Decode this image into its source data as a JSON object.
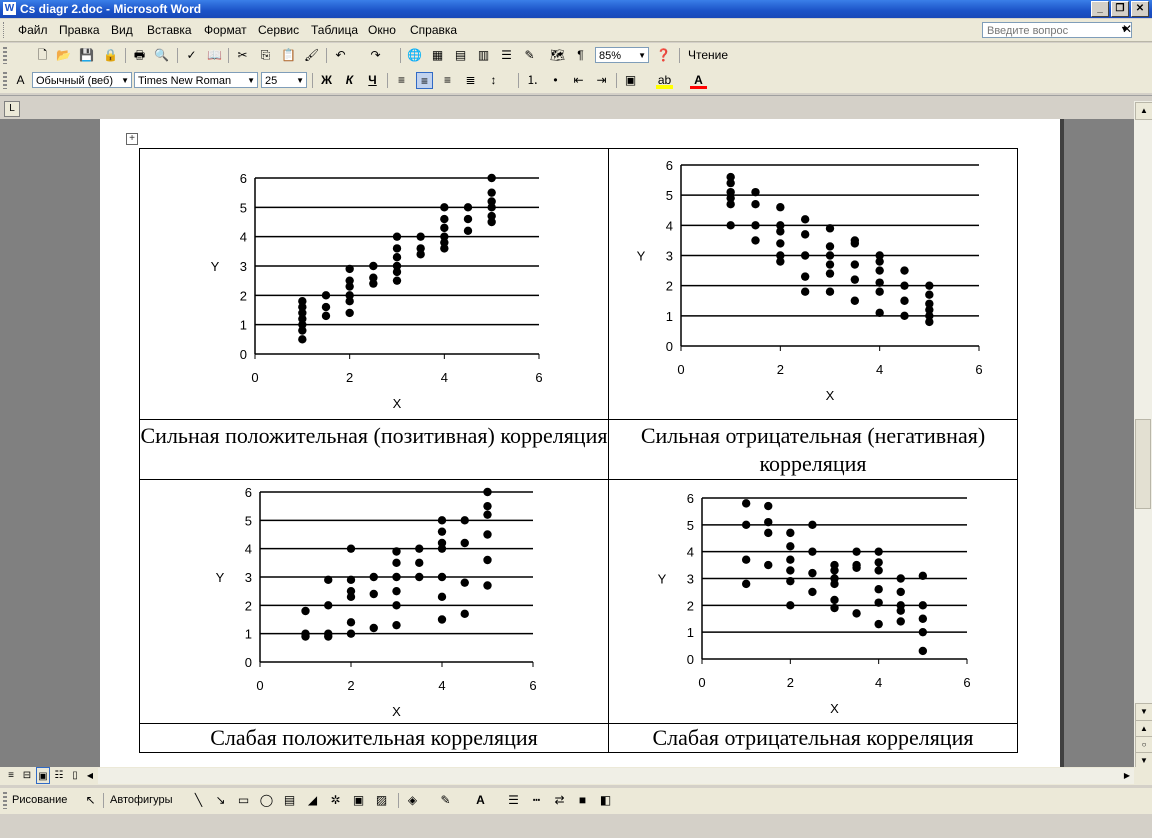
{
  "window": {
    "title": "Cs diagr 2.doc - Microsoft Word",
    "minimize": "_",
    "restore": "❐",
    "close": "✕"
  },
  "menubar": {
    "items": [
      "Файл",
      "Правка",
      "Вид",
      "Вставка",
      "Формат",
      "Сервис",
      "Таблица",
      "Окно",
      "Справка"
    ],
    "ask_placeholder": "Введите вопрос"
  },
  "toolbar": {
    "zoom": "85%",
    "reading": "Чтение",
    "style": "Обычный (веб)",
    "font": "Times New Roman",
    "size": "25",
    "bold": "Ж",
    "italic": "К",
    "underline": "Ч"
  },
  "drawing": {
    "draw_label": "Рисование",
    "autoshapes_label": "Автофигуры"
  },
  "charts": [
    {
      "type": "scatter",
      "xlabel": "X",
      "ylabel": "Y",
      "xlim": [
        0,
        6
      ],
      "ylim": [
        0,
        6
      ],
      "xticks": [
        0,
        2,
        4,
        6
      ],
      "yticks": [
        0,
        1,
        2,
        3,
        4,
        5,
        6
      ],
      "points": [
        [
          1,
          0.5
        ],
        [
          1,
          0.8
        ],
        [
          1,
          1.0
        ],
        [
          1,
          1.2
        ],
        [
          1,
          1.4
        ],
        [
          1,
          1.6
        ],
        [
          1,
          1.8
        ],
        [
          1.5,
          1.3
        ],
        [
          1.5,
          1.6
        ],
        [
          1.5,
          2.0
        ],
        [
          2,
          1.4
        ],
        [
          2,
          1.8
        ],
        [
          2,
          2.0
        ],
        [
          2,
          2.3
        ],
        [
          2,
          2.5
        ],
        [
          2,
          2.9
        ],
        [
          2.5,
          2.4
        ],
        [
          2.5,
          2.6
        ],
        [
          2.5,
          3.0
        ],
        [
          3,
          2.5
        ],
        [
          3,
          2.8
        ],
        [
          3,
          3.0
        ],
        [
          3,
          3.3
        ],
        [
          3,
          3.6
        ],
        [
          3,
          4.0
        ],
        [
          3.5,
          3.4
        ],
        [
          3.5,
          3.6
        ],
        [
          3.5,
          4.0
        ],
        [
          4,
          3.6
        ],
        [
          4,
          3.8
        ],
        [
          4,
          4.0
        ],
        [
          4,
          4.3
        ],
        [
          4,
          4.6
        ],
        [
          4,
          5.0
        ],
        [
          4.5,
          4.2
        ],
        [
          4.5,
          4.6
        ],
        [
          4.5,
          5.0
        ],
        [
          5,
          4.5
        ],
        [
          5,
          4.7
        ],
        [
          5,
          5.0
        ],
        [
          5,
          5.2
        ],
        [
          5,
          5.5
        ],
        [
          5,
          6.0
        ]
      ]
    },
    {
      "type": "scatter",
      "xlabel": "X",
      "ylabel": "Y",
      "xlim": [
        0,
        6
      ],
      "ylim": [
        0,
        6
      ],
      "xticks": [
        0,
        2,
        4,
        6
      ],
      "yticks": [
        0,
        1,
        2,
        3,
        4,
        5,
        6
      ],
      "points": [
        [
          1,
          4.0
        ],
        [
          1,
          4.7
        ],
        [
          1,
          4.9
        ],
        [
          1,
          5.1
        ],
        [
          1,
          5.4
        ],
        [
          1,
          5.6
        ],
        [
          1.5,
          3.5
        ],
        [
          1.5,
          4.0
        ],
        [
          1.5,
          4.7
        ],
        [
          1.5,
          5.1
        ],
        [
          2,
          2.8
        ],
        [
          2,
          3.0
        ],
        [
          2,
          3.4
        ],
        [
          2,
          3.8
        ],
        [
          2,
          4.0
        ],
        [
          2,
          4.6
        ],
        [
          2.5,
          1.8
        ],
        [
          2.5,
          2.3
        ],
        [
          2.5,
          3.0
        ],
        [
          2.5,
          3.7
        ],
        [
          2.5,
          4.2
        ],
        [
          3,
          1.8
        ],
        [
          3,
          2.4
        ],
        [
          3,
          2.7
        ],
        [
          3,
          3.0
        ],
        [
          3,
          3.3
        ],
        [
          3,
          3.9
        ],
        [
          3.5,
          1.5
        ],
        [
          3.5,
          2.2
        ],
        [
          3.5,
          2.7
        ],
        [
          3.5,
          3.4
        ],
        [
          3.5,
          3.5
        ],
        [
          4,
          1.1
        ],
        [
          4,
          1.8
        ],
        [
          4,
          2.1
        ],
        [
          4,
          2.5
        ],
        [
          4,
          2.8
        ],
        [
          4,
          3.0
        ],
        [
          4.5,
          1.0
        ],
        [
          4.5,
          1.5
        ],
        [
          4.5,
          2.0
        ],
        [
          4.5,
          2.5
        ],
        [
          5,
          0.8
        ],
        [
          5,
          1.0
        ],
        [
          5,
          1.2
        ],
        [
          5,
          1.4
        ],
        [
          5,
          1.7
        ],
        [
          5,
          2.0
        ]
      ]
    },
    {
      "type": "scatter",
      "xlabel": "X",
      "ylabel": "Y",
      "xlim": [
        0,
        6
      ],
      "ylim": [
        0,
        6
      ],
      "xticks": [
        0,
        2,
        4,
        6
      ],
      "yticks": [
        0,
        1,
        2,
        3,
        4,
        5,
        6
      ],
      "points": [
        [
          1,
          0.9
        ],
        [
          1,
          1.0
        ],
        [
          1,
          1.8
        ],
        [
          1.5,
          0.9
        ],
        [
          1.5,
          1.0
        ],
        [
          1.5,
          2.0
        ],
        [
          1.5,
          2.9
        ],
        [
          2,
          1.0
        ],
        [
          2,
          1.4
        ],
        [
          2,
          2.3
        ],
        [
          2,
          2.5
        ],
        [
          2,
          2.9
        ],
        [
          2,
          4.0
        ],
        [
          2.5,
          1.2
        ],
        [
          2.5,
          2.4
        ],
        [
          2.5,
          3.0
        ],
        [
          3,
          1.3
        ],
        [
          3,
          2.0
        ],
        [
          3,
          2.5
        ],
        [
          3,
          3.0
        ],
        [
          3,
          3.5
        ],
        [
          3,
          3.9
        ],
        [
          3.5,
          3.0
        ],
        [
          3.5,
          3.5
        ],
        [
          3.5,
          4.0
        ],
        [
          4,
          1.5
        ],
        [
          4,
          2.3
        ],
        [
          4,
          3.0
        ],
        [
          4,
          4.0
        ],
        [
          4,
          4.2
        ],
        [
          4,
          4.6
        ],
        [
          4,
          5.0
        ],
        [
          4.5,
          1.7
        ],
        [
          4.5,
          2.8
        ],
        [
          4.5,
          4.2
        ],
        [
          4.5,
          5.0
        ],
        [
          5,
          2.7
        ],
        [
          5,
          3.6
        ],
        [
          5,
          4.5
        ],
        [
          5,
          5.2
        ],
        [
          5,
          5.5
        ],
        [
          5,
          6.0
        ]
      ]
    },
    {
      "type": "scatter",
      "xlabel": "X",
      "ylabel": "Y",
      "xlim": [
        0,
        6
      ],
      "ylim": [
        0,
        6
      ],
      "xticks": [
        0,
        2,
        4,
        6
      ],
      "yticks": [
        0,
        1,
        2,
        3,
        4,
        5,
        6
      ],
      "points": [
        [
          1,
          2.8
        ],
        [
          1,
          3.7
        ],
        [
          1,
          5.0
        ],
        [
          1,
          5.8
        ],
        [
          1.5,
          3.5
        ],
        [
          1.5,
          4.7
        ],
        [
          1.5,
          5.1
        ],
        [
          1.5,
          5.7
        ],
        [
          2,
          2.0
        ],
        [
          2,
          2.9
        ],
        [
          2,
          3.3
        ],
        [
          2,
          3.7
        ],
        [
          2,
          4.2
        ],
        [
          2,
          4.7
        ],
        [
          2.5,
          2.5
        ],
        [
          2.5,
          3.2
        ],
        [
          2.5,
          4.0
        ],
        [
          2.5,
          5.0
        ],
        [
          3,
          1.9
        ],
        [
          3,
          2.2
        ],
        [
          3,
          2.8
        ],
        [
          3,
          3.0
        ],
        [
          3,
          3.3
        ],
        [
          3,
          3.5
        ],
        [
          3.5,
          1.7
        ],
        [
          3.5,
          3.4
        ],
        [
          3.5,
          3.5
        ],
        [
          3.5,
          4.0
        ],
        [
          4,
          1.3
        ],
        [
          4,
          2.1
        ],
        [
          4,
          2.6
        ],
        [
          4,
          3.3
        ],
        [
          4,
          3.6
        ],
        [
          4,
          4.0
        ],
        [
          4.5,
          1.4
        ],
        [
          4.5,
          1.8
        ],
        [
          4.5,
          2.0
        ],
        [
          4.5,
          2.5
        ],
        [
          4.5,
          3.0
        ],
        [
          5,
          0.3
        ],
        [
          5,
          1.0
        ],
        [
          5,
          1.5
        ],
        [
          5,
          2.0
        ],
        [
          5,
          3.1
        ]
      ]
    }
  ],
  "captions": {
    "c1": "Сильная положительная (позитивная) корреляция",
    "c2": "Сильная отрицательная (негативная) корреляция",
    "c3": "Слабая положительная корреляция",
    "c4": "Слабая отрицательная корреляция"
  }
}
